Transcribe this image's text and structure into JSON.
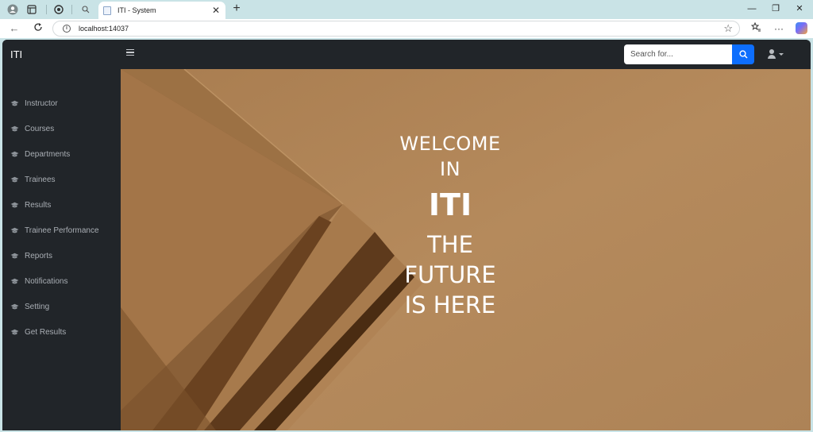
{
  "browser": {
    "tab_title": "ITI - System",
    "url": "localhost:14037"
  },
  "app": {
    "brand": "ITI",
    "search": {
      "placeholder": "Search for..."
    },
    "sidebar": {
      "items": [
        {
          "label": "Instructor"
        },
        {
          "label": "Courses"
        },
        {
          "label": "Departments"
        },
        {
          "label": "Trainees"
        },
        {
          "label": "Results"
        },
        {
          "label": "Trainee Performance"
        },
        {
          "label": "Reports"
        },
        {
          "label": "Notifications"
        },
        {
          "label": "Setting"
        },
        {
          "label": "Get Results"
        }
      ]
    },
    "hero": {
      "line1": "WELCOME",
      "line2": "IN",
      "line3": "ITI",
      "line4": "THE",
      "line5": "FUTURE",
      "line6": "IS HERE"
    }
  },
  "colors": {
    "navbar": "#212529",
    "accent": "#0d6efd",
    "hero_background": "#b08558"
  }
}
